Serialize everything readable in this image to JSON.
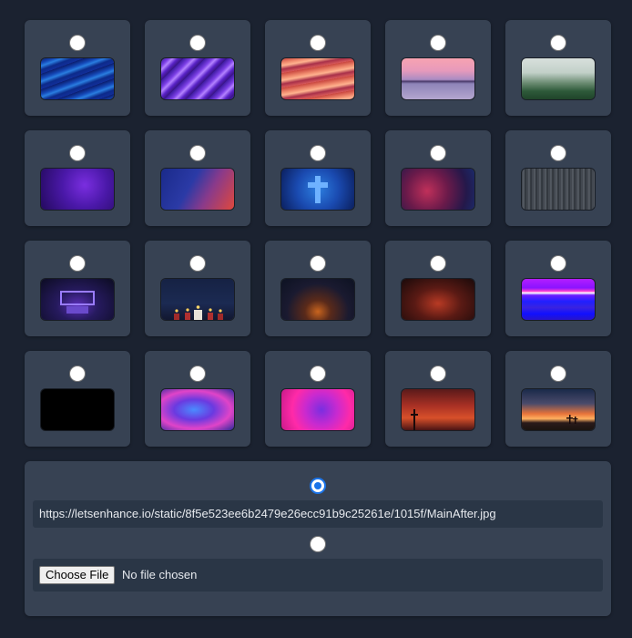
{
  "backgrounds": [
    {
      "name": "blue-brushstrokes-thumbnail",
      "selected": false
    },
    {
      "name": "purple-brushstrokes-thumbnail",
      "selected": false
    },
    {
      "name": "coral-brushstrokes-thumbnail",
      "selected": false
    },
    {
      "name": "pink-sunset-lake-thumbnail",
      "selected": false
    },
    {
      "name": "misty-green-forest-thumbnail",
      "selected": false
    },
    {
      "name": "purple-texture-thumbnail",
      "selected": false
    },
    {
      "name": "blue-red-texture-thumbnail",
      "selected": false
    },
    {
      "name": "blue-cross-thumbnail",
      "selected": false
    },
    {
      "name": "red-blue-grunge-thumbnail",
      "selected": false
    },
    {
      "name": "gray-winter-forest-thumbnail",
      "selected": false
    },
    {
      "name": "purple-stage-thumbnail",
      "selected": false
    },
    {
      "name": "candles-thumbnail",
      "selected": false
    },
    {
      "name": "dark-doorway-thumbnail",
      "selected": false
    },
    {
      "name": "red-dark-room-thumbnail",
      "selected": false
    },
    {
      "name": "purple-blue-stripes-thumbnail",
      "selected": false
    },
    {
      "name": "black-thumbnail",
      "selected": false
    },
    {
      "name": "blue-purple-abstract-thumbnail",
      "selected": false
    },
    {
      "name": "magenta-abstract-thumbnail",
      "selected": false
    },
    {
      "name": "red-sky-cross-thumbnail",
      "selected": false
    },
    {
      "name": "sunset-crosses-thumbnail",
      "selected": false
    }
  ],
  "custom": {
    "url_selected": true,
    "url": "https://letsenhance.io/static/8f5e523ee6b2479e26ecc91b9c25261e/1015f/MainAfter.jpg",
    "file_button_label": "Choose File",
    "file_status": "No file chosen"
  }
}
